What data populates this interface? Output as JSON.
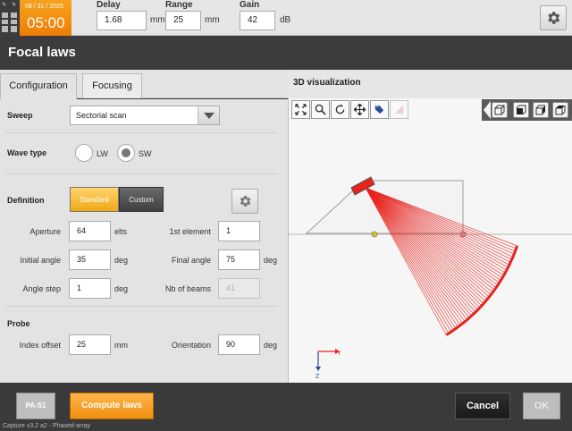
{
  "topbar": {
    "date": "08 / 31 / 2020",
    "time": "05:00",
    "delay": {
      "label": "Delay",
      "value": "1.68",
      "unit": "mm"
    },
    "range": {
      "label": "Range",
      "value": "25",
      "unit": "mm"
    },
    "gain": {
      "label": "Gain",
      "value": "42",
      "unit": "dB"
    }
  },
  "title": "Focal laws",
  "tabs": [
    "Configuration",
    "Focusing"
  ],
  "viz_title": "3D visualization",
  "sweep": {
    "label": "Sweep",
    "value": "Sectorial scan"
  },
  "wave_type": {
    "label": "Wave type",
    "options": [
      "LW",
      "SW"
    ],
    "selected": "SW"
  },
  "definition": {
    "label": "Definition",
    "modes": [
      "Standard",
      "Custom"
    ],
    "selected": "Standard",
    "fields": [
      {
        "label": "Aperture",
        "value": "64",
        "unit": "elts"
      },
      {
        "label": "1st element",
        "value": "1",
        "unit": ""
      },
      {
        "label": "Initial angle",
        "value": "35",
        "unit": "deg"
      },
      {
        "label": "Final angle",
        "value": "75",
        "unit": "deg"
      },
      {
        "label": "Angle step",
        "value": "1",
        "unit": "deg"
      },
      {
        "label": "Nb of beams",
        "value": "41",
        "unit": ""
      }
    ]
  },
  "probe": {
    "label": "Probe",
    "fields": [
      {
        "label": "Index offset",
        "value": "25",
        "unit": "mm"
      },
      {
        "label": "Orientation",
        "value": "90",
        "unit": "deg"
      }
    ]
  },
  "axes": {
    "y": "Y",
    "z": "Z"
  },
  "colors": {
    "accent": "#f08f10",
    "beam": "#e8221c",
    "dark": "#3a3a3a"
  },
  "bottom": {
    "probe_tag": "PA-S1",
    "compute": "Compute laws",
    "cancel": "Cancel",
    "ok": "OK",
    "version": "Capture v3.2 a2 - Phased-array"
  }
}
